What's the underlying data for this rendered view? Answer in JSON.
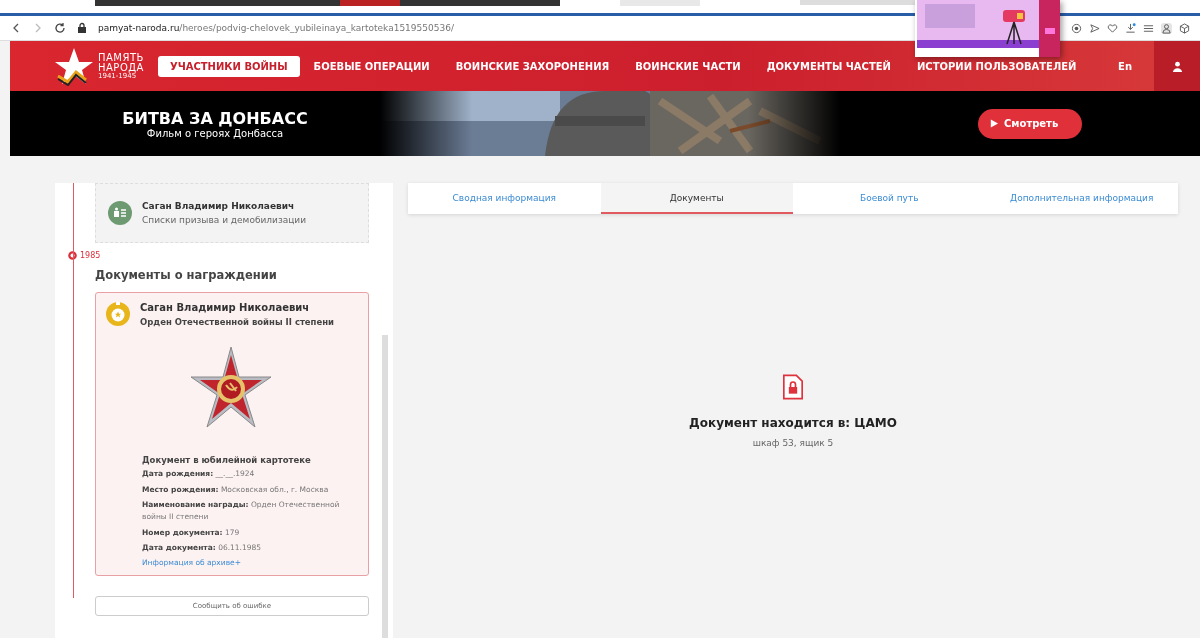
{
  "browser": {
    "url_host": "pamyat-naroda.ru",
    "url_path": "/heroes/podvig-chelovek_yubileinaya_kartoteka1519550536/"
  },
  "nav": {
    "logo": [
      "ПАМЯТЬ",
      "НАРОДА",
      "1941-1945"
    ],
    "items": [
      {
        "label": "УЧАСТНИКИ ВОЙНЫ",
        "selected": true
      },
      {
        "label": "БОЕВЫЕ ОПЕРАЦИИ",
        "selected": false
      },
      {
        "label": "ВОИНСКИЕ ЗАХОРОНЕНИЯ",
        "selected": false
      },
      {
        "label": "ВОИНСКИЕ ЧАСТИ",
        "selected": false
      },
      {
        "label": "ДОКУМЕНТЫ ЧАСТЕЙ",
        "selected": false
      },
      {
        "label": "ИСТОРИИ ПОЛЬЗОВАТЕЛЕЙ",
        "selected": false
      }
    ],
    "language": "En"
  },
  "banner": {
    "title": "БИТВА ЗА ДОНБАСС",
    "subtitle": "Фильм о героях Донбасса",
    "button": "Смотреть"
  },
  "record_card": {
    "name": "Саган Владимир Николаевич",
    "source": "Списки призыва и демобилизации"
  },
  "year": "1985",
  "section_title": "Документы о награждении",
  "award_card": {
    "name": "Саган Владимир Николаевич",
    "award": "Орден Отечественной войны II степени",
    "doc_title": "Документ в юбилейной картотеке",
    "fields": [
      "**Дата рождения:** __.__.1924",
      "**Место рождения:** Московская обл., г. Москва",
      "**Наименование награды:** Орден Отечественной войны II степени",
      "**Номер документа:** 179",
      "**Дата документа:** 06.11.1985"
    ],
    "archive_link": "Информация об архиве+"
  },
  "report_button": "Сообщить об ошибке",
  "tabs": [
    {
      "label": "Сводная информация",
      "selected": false
    },
    {
      "label": "Документы",
      "selected": true
    },
    {
      "label": "Боевой путь",
      "selected": false
    },
    {
      "label": "Дополнительная информация",
      "selected": false
    }
  ],
  "document": {
    "location": "Документ находится в: ЦАМО",
    "shelf": "шкаф 53, ящик 5"
  }
}
